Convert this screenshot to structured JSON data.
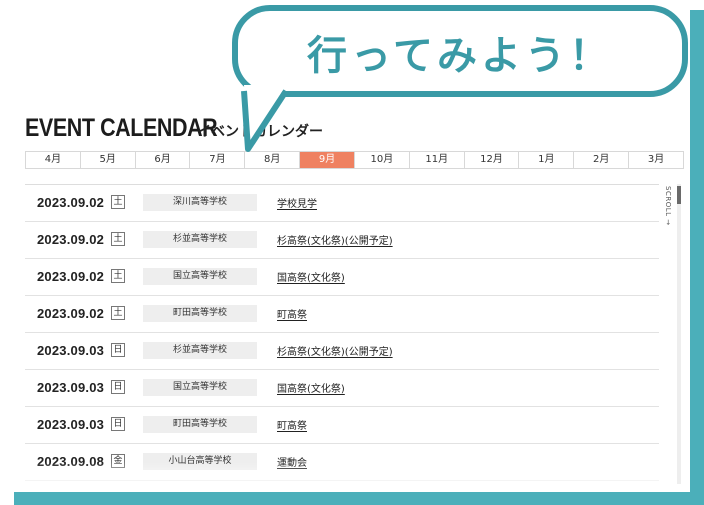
{
  "bubble": {
    "text": "行ってみよう！"
  },
  "header": {
    "title": "EVENT CALENDAR",
    "subtitle": "イベントカレンダー"
  },
  "months": [
    {
      "label": "4月",
      "active": false
    },
    {
      "label": "5月",
      "active": false
    },
    {
      "label": "6月",
      "active": false
    },
    {
      "label": "7月",
      "active": false
    },
    {
      "label": "8月",
      "active": false
    },
    {
      "label": "9月",
      "active": true
    },
    {
      "label": "10月",
      "active": false
    },
    {
      "label": "11月",
      "active": false
    },
    {
      "label": "12月",
      "active": false
    },
    {
      "label": "1月",
      "active": false
    },
    {
      "label": "2月",
      "active": false
    },
    {
      "label": "3月",
      "active": false
    }
  ],
  "events": [
    {
      "date": "2023.09.02",
      "dow": "土",
      "school": "深川高等学校",
      "event": "学校見学"
    },
    {
      "date": "2023.09.02",
      "dow": "土",
      "school": "杉並高等学校",
      "event": "杉高祭(文化祭)(公開予定)"
    },
    {
      "date": "2023.09.02",
      "dow": "土",
      "school": "国立高等学校",
      "event": "国高祭(文化祭)"
    },
    {
      "date": "2023.09.02",
      "dow": "土",
      "school": "町田高等学校",
      "event": "町高祭"
    },
    {
      "date": "2023.09.03",
      "dow": "日",
      "school": "杉並高等学校",
      "event": "杉高祭(文化祭)(公開予定)"
    },
    {
      "date": "2023.09.03",
      "dow": "日",
      "school": "国立高等学校",
      "event": "国高祭(文化祭)"
    },
    {
      "date": "2023.09.03",
      "dow": "日",
      "school": "町田高等学校",
      "event": "町高祭"
    },
    {
      "date": "2023.09.08",
      "dow": "金",
      "school": "小山台高等学校",
      "event": "運動会"
    }
  ],
  "scroll": {
    "label": "SCROLL →"
  },
  "colors": {
    "accent": "#ef8161",
    "frame": "#4bafba",
    "bubble": "#3a9aa6"
  }
}
